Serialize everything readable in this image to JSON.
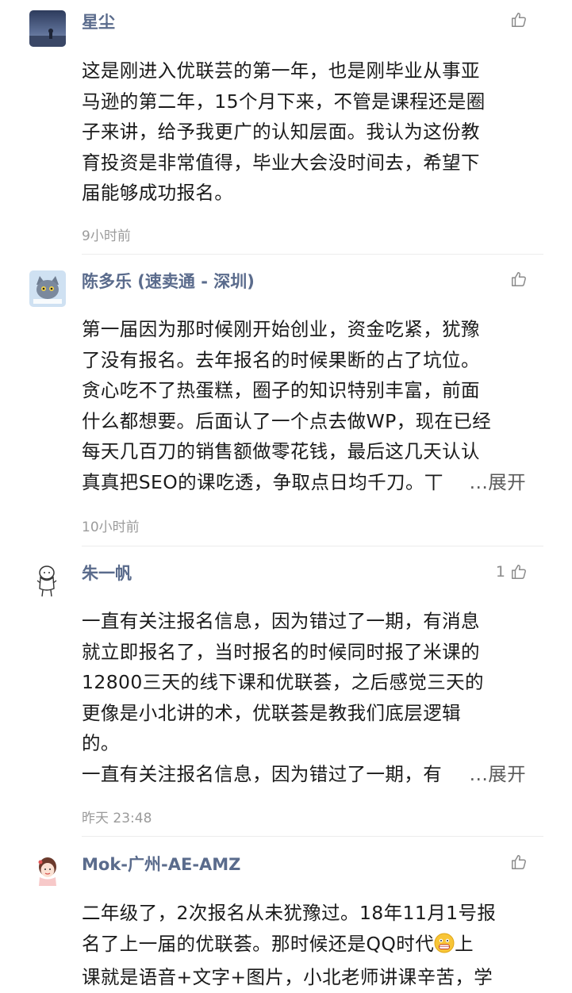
{
  "comments": [
    {
      "name": "星尘",
      "like_count": "",
      "lines": [
        "这是刚进入优联芸的第一年，也是刚毕业从事亚",
        "马逊的第二年，15个月下来，不管是课程还是圈",
        "子来讲，给予我更广的认知层面。我认为这份教",
        "育投资是非常值得，毕业大会没时间去，希望下",
        "届能够成功报名。"
      ],
      "time": "9小时前"
    },
    {
      "name": "陈多乐 (速卖通 - 深圳)",
      "like_count": "",
      "lines": [
        "第一届因为那时候刚开始创业，资金吃紧，犹豫",
        "了没有报名。去年报名的时候果断的占了坑位。",
        "贪心吃不了热蛋糕，圈子的知识特别丰富，前面",
        "什么都想要。后面认了一个点去做WP，现在已经",
        "每天几百刀的销售额做零花钱，最后这几天认认",
        "真真把SEO的课吃透，争取点日均千刀。丅"
      ],
      "more": "...展开",
      "time": "10小时前"
    },
    {
      "name": "朱一帆",
      "like_count": "1",
      "lines": [
        "一直有关注报名信息，因为错过了一期，有消息",
        "就立即报名了，当时报名的时候同时报了米课的",
        "12800三天的线下课和优联荟，之后感觉三天的",
        "更像是小北讲的术，优联荟是教我们底层逻辑",
        "的。",
        "一直有关注报名信息，因为错过了一期，有"
      ],
      "more": "...展开",
      "time": "昨天 23:48"
    },
    {
      "name": "Mok-广州-AE-AMZ",
      "like_count": "",
      "lines": [
        "二年级了，2次报名从未犹豫过。18年11月1号报",
        "名了上一届的优联荟。那时候还是QQ时代",
        "课就是语音+文字+图片，小北老师讲课辛苦，学"
      ],
      "emoji_line_suffix": "上",
      "time": ""
    }
  ]
}
